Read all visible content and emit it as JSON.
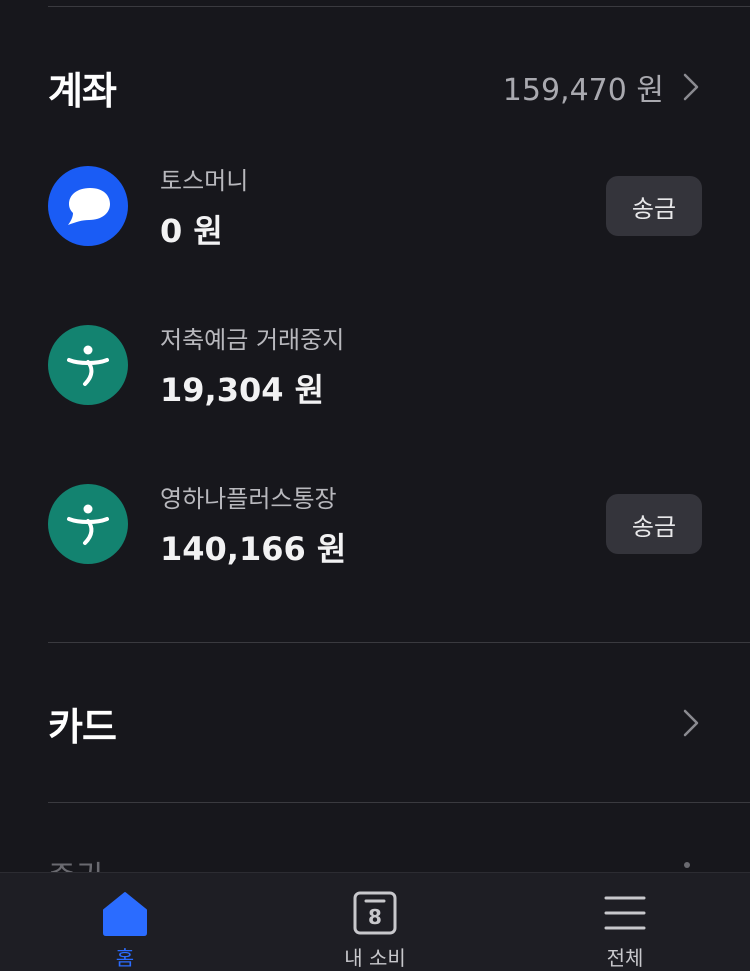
{
  "accounts_section": {
    "title": "계좌",
    "total": "159,470 원",
    "send_label": "송금",
    "items": [
      {
        "name": "토스머니",
        "balance": "0 원",
        "logo": "toss-logo-icon"
      },
      {
        "name": "저축예금 거래중지",
        "balance": "19,304 원",
        "logo": "hana-bank-logo-icon"
      },
      {
        "name": "영하나플러스통장",
        "balance": "140,166 원",
        "logo": "hana-bank-logo-icon"
      }
    ]
  },
  "cards_section": {
    "title": "카드"
  },
  "next_section_peek": "증권",
  "tabbar": {
    "items": [
      {
        "label": "홈",
        "icon": "home-icon",
        "active": true
      },
      {
        "label": "내 소비",
        "icon": "calendar-8-icon",
        "badge": "8"
      },
      {
        "label": "전체",
        "icon": "menu-icon"
      }
    ]
  },
  "colors": {
    "background": "#17171c",
    "accent": "#2b6cff",
    "toss_blue": "#1a5cf5",
    "hana_green": "#138370"
  }
}
